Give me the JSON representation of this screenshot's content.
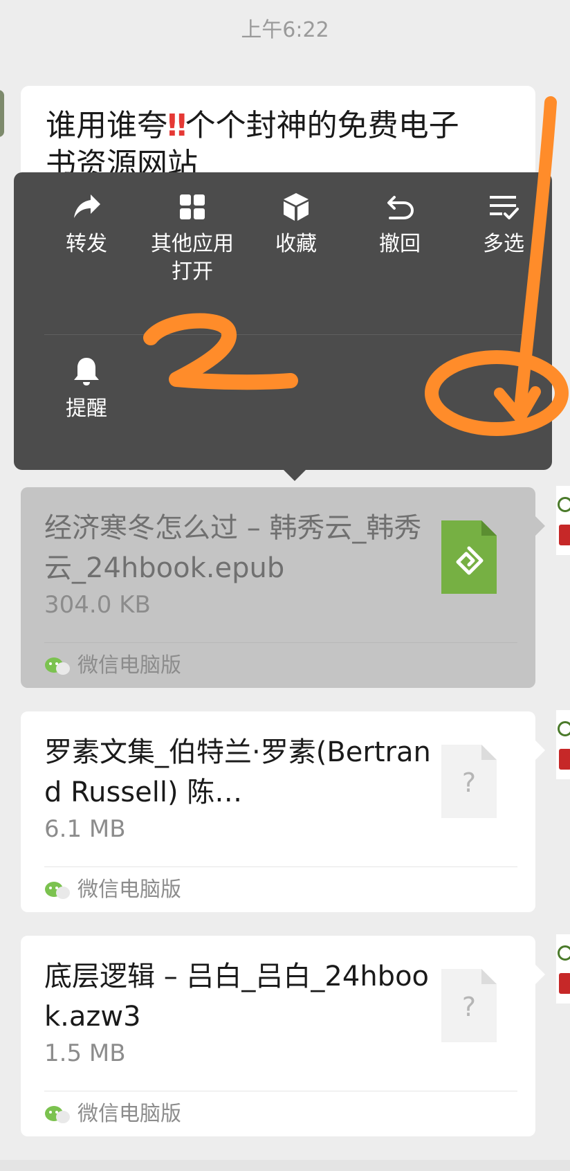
{
  "chat": {
    "timestamp": "上午6:22",
    "text_message_line1": "谁用谁夸",
    "text_message_emoji": "‼",
    "text_message_line1_rest": "个个封神的免费电子",
    "text_message_line2": "书资源网站"
  },
  "context_menu": {
    "items": [
      {
        "label": "转发",
        "icon": "forward-icon"
      },
      {
        "label": "其他应用打开",
        "icon": "apps-grid-icon"
      },
      {
        "label": "收藏",
        "icon": "favorite-cube-icon"
      },
      {
        "label": "撤回",
        "icon": "recall-undo-icon"
      },
      {
        "label": "多选",
        "icon": "multi-select-icon"
      },
      {
        "label": "提醒",
        "icon": "bell-icon"
      }
    ]
  },
  "files": [
    {
      "name": "经济寒冬怎么过 – 韩秀云_韩秀云_24hbook.epub",
      "size": "304.0 KB",
      "source": "微信电脑版",
      "icon": "epub-file-icon",
      "selected": true
    },
    {
      "name": "罗素文集_伯特兰·罗素(Bertrand Russell) 陈…",
      "size": "6.1 MB",
      "source": "微信电脑版",
      "icon": "unknown-file-icon",
      "selected": false
    },
    {
      "name": "底层逻辑 – 吕白_吕白_24hbook.azw3",
      "size": "1.5 MB",
      "source": "微信电脑版",
      "icon": "unknown-file-icon",
      "selected": false
    }
  ],
  "annotations": {
    "handwritten_number": "2",
    "stroke_color": "#ff8c2a"
  },
  "colors": {
    "menu_background": "#4c4c4c",
    "page_background": "#ededed",
    "epub_green": "#76b043",
    "wechat_green": "#7bc24f"
  }
}
